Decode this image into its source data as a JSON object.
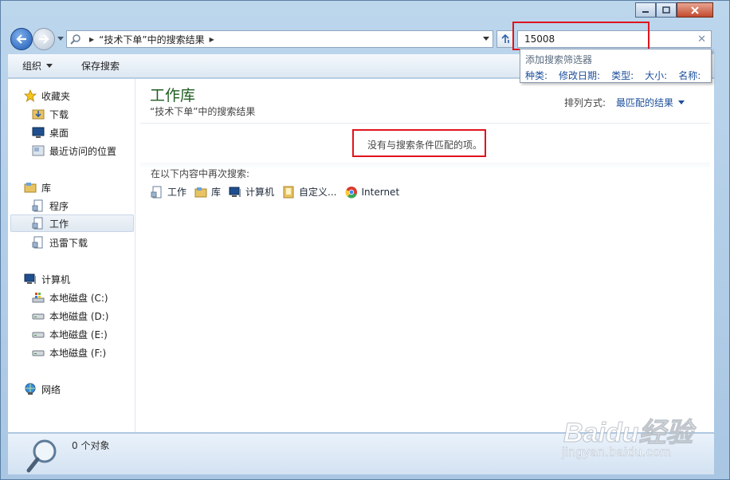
{
  "address": {
    "breadcrumb": "“技术下单”中的搜索结果"
  },
  "search": {
    "value": "15008",
    "clear_icon": "✕"
  },
  "toolbar": {
    "organize_label": "组织",
    "save_search_label": "保存搜索"
  },
  "search_popup": {
    "title": "添加搜索筛选器",
    "filters": [
      "种类:",
      "修改日期:",
      "类型:",
      "大小:",
      "名称:"
    ]
  },
  "sidebar": {
    "favorites": {
      "label": "收藏夹",
      "items": [
        "下载",
        "桌面",
        "最近访问的位置"
      ]
    },
    "libraries": {
      "label": "库",
      "items": [
        "程序",
        "工作",
        "迅雷下载"
      ]
    },
    "computer": {
      "label": "计算机",
      "items": [
        "本地磁盘 (C:)",
        "本地磁盘 (D:)",
        "本地磁盘 (E:)",
        "本地磁盘 (F:)"
      ]
    },
    "network": {
      "label": "网络"
    }
  },
  "main": {
    "title": "工作库",
    "subtitle": "“技术下单”中的搜索结果",
    "sort_label": "排列方式:",
    "sort_value": "最匹配的结果",
    "no_match": "没有与搜索条件匹配的项。",
    "search_again_label": "在以下内容中再次搜索:",
    "search_again_items": [
      "工作",
      "库",
      "计算机",
      "自定义...",
      "Internet"
    ]
  },
  "status": {
    "text": "0 个对象"
  },
  "watermark": {
    "brand": "Baidu经验",
    "url": "jingyan.baidu.com"
  },
  "colors": {
    "title_green": "#1e5d20",
    "link_blue": "#1c4f9b",
    "highlight_red": "#e0141e"
  }
}
